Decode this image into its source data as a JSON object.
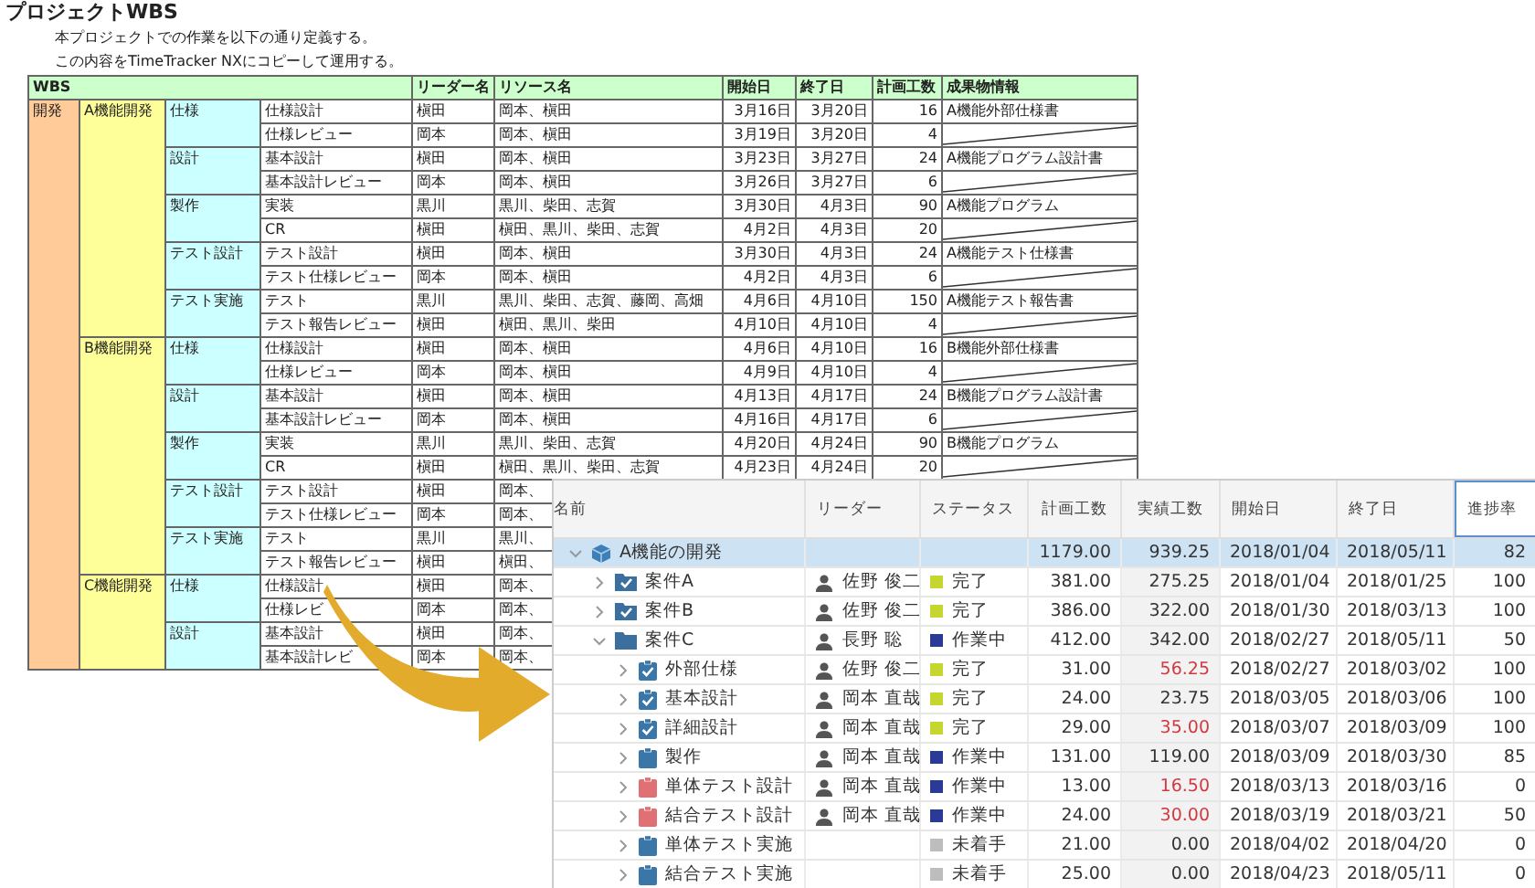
{
  "title": "プロジェクトWBS",
  "intro": [
    "本プロジェクトでの作業を以下の通り定義する。",
    "この内容をTimeTracker NXにコピーして運用する。"
  ],
  "wbs": {
    "columns": [
      "WBS",
      "リーダー名",
      "リソース名",
      "開始日",
      "終了日",
      "計画工数",
      "成果物情報"
    ],
    "groups": [
      {
        "name": "開発",
        "features": [
          {
            "name": "A機能開発",
            "phases": [
              {
                "name": "仕様",
                "tasks": [
                  {
                    "name": "仕様設計",
                    "leader": "槇田",
                    "resources": "岡本、槇田",
                    "start": "3月16日",
                    "end": "3月20日",
                    "hours": "16",
                    "deliverable": "A機能外部仕様書"
                  },
                  {
                    "name": "仕様レビュー",
                    "leader": "岡本",
                    "resources": "岡本、槇田",
                    "start": "3月19日",
                    "end": "3月20日",
                    "hours": "4"
                  }
                ]
              },
              {
                "name": "設計",
                "tasks": [
                  {
                    "name": "基本設計",
                    "leader": "槇田",
                    "resources": "岡本、槇田",
                    "start": "3月23日",
                    "end": "3月27日",
                    "hours": "24",
                    "deliverable": "A機能プログラム設計書"
                  },
                  {
                    "name": "基本設計レビュー",
                    "leader": "岡本",
                    "resources": "岡本、槇田",
                    "start": "3月26日",
                    "end": "3月27日",
                    "hours": "6"
                  }
                ]
              },
              {
                "name": "製作",
                "tasks": [
                  {
                    "name": "実装",
                    "leader": "黒川",
                    "resources": "黒川、柴田、志賀",
                    "start": "3月30日",
                    "end": "4月3日",
                    "hours": "90",
                    "deliverable": "A機能プログラム"
                  },
                  {
                    "name": "CR",
                    "leader": "槇田",
                    "resources": "槇田、黒川、柴田、志賀",
                    "start": "4月2日",
                    "end": "4月3日",
                    "hours": "20"
                  }
                ]
              },
              {
                "name": "テスト設計",
                "tasks": [
                  {
                    "name": "テスト設計",
                    "leader": "槇田",
                    "resources": "岡本、槇田",
                    "start": "3月30日",
                    "end": "4月3日",
                    "hours": "24",
                    "deliverable": "A機能テスト仕様書"
                  },
                  {
                    "name": "テスト仕様レビュー",
                    "leader": "岡本",
                    "resources": "岡本、槇田",
                    "start": "4月2日",
                    "end": "4月3日",
                    "hours": "6"
                  }
                ]
              },
              {
                "name": "テスト実施",
                "tasks": [
                  {
                    "name": "テスト",
                    "leader": "黒川",
                    "resources": "黒川、柴田、志賀、藤岡、高畑",
                    "start": "4月6日",
                    "end": "4月10日",
                    "hours": "150",
                    "deliverable": "A機能テスト報告書"
                  },
                  {
                    "name": "テスト報告レビュー",
                    "leader": "槇田",
                    "resources": "槇田、黒川、柴田",
                    "start": "4月10日",
                    "end": "4月10日",
                    "hours": "4"
                  }
                ]
              }
            ]
          },
          {
            "name": "B機能開発",
            "phases": [
              {
                "name": "仕様",
                "tasks": [
                  {
                    "name": "仕様設計",
                    "leader": "槇田",
                    "resources": "岡本、槇田",
                    "start": "4月6日",
                    "end": "4月10日",
                    "hours": "16",
                    "deliverable": "B機能外部仕様書"
                  },
                  {
                    "name": "仕様レビュー",
                    "leader": "岡本",
                    "resources": "岡本、槇田",
                    "start": "4月9日",
                    "end": "4月10日",
                    "hours": "4"
                  }
                ]
              },
              {
                "name": "設計",
                "tasks": [
                  {
                    "name": "基本設計",
                    "leader": "槇田",
                    "resources": "岡本、槇田",
                    "start": "4月13日",
                    "end": "4月17日",
                    "hours": "24",
                    "deliverable": "B機能プログラム設計書"
                  },
                  {
                    "name": "基本設計レビュー",
                    "leader": "岡本",
                    "resources": "岡本、槇田",
                    "start": "4月16日",
                    "end": "4月17日",
                    "hours": "6"
                  }
                ]
              },
              {
                "name": "製作",
                "tasks": [
                  {
                    "name": "実装",
                    "leader": "黒川",
                    "resources": "黒川、柴田、志賀",
                    "start": "4月20日",
                    "end": "4月24日",
                    "hours": "90",
                    "deliverable": "B機能プログラム"
                  },
                  {
                    "name": "CR",
                    "leader": "槇田",
                    "resources": "槇田、黒川、柴田、志賀",
                    "start": "4月23日",
                    "end": "4月24日",
                    "hours": "20"
                  }
                ]
              },
              {
                "name": "テスト設計",
                "tasks": [
                  {
                    "name": "テスト設計",
                    "leader": "槇田",
                    "resources": "岡本、"
                  },
                  {
                    "name": "テスト仕様レビュー",
                    "leader": "岡本",
                    "resources": "岡本、"
                  }
                ]
              },
              {
                "name": "テスト実施",
                "tasks": [
                  {
                    "name": "テスト",
                    "leader": "黒川",
                    "resources": "黒川、"
                  },
                  {
                    "name": "テスト報告レビュー",
                    "leader": "槇田",
                    "resources": "槇田、"
                  }
                ]
              }
            ]
          },
          {
            "name": "C機能開発",
            "phases": [
              {
                "name": "仕様",
                "tasks": [
                  {
                    "name": "仕様設計",
                    "leader": "槇田",
                    "resources": "岡本、"
                  },
                  {
                    "name": "仕様レビ",
                    "leader": "岡本",
                    "resources": "岡本、"
                  }
                ]
              },
              {
                "name": "設計",
                "tasks": [
                  {
                    "name": "基本設計",
                    "leader": "槇田",
                    "resources": "岡本、"
                  },
                  {
                    "name": "基本設計レビ",
                    "leader": "岡本",
                    "resources": "岡本、"
                  }
                ]
              }
            ]
          }
        ]
      }
    ]
  },
  "tracker": {
    "columns": [
      {
        "label": "名前",
        "selected": false
      },
      {
        "label": "リーダー",
        "selected": false
      },
      {
        "label": "ステータス",
        "selected": false
      },
      {
        "label": "計画工数",
        "selected": false
      },
      {
        "label": "実績工数",
        "selected": false
      },
      {
        "label": "開始日",
        "selected": false
      },
      {
        "label": "終了日",
        "selected": false
      },
      {
        "label": "進捗率",
        "selected": true
      }
    ],
    "rows": [
      {
        "name": "A機能の開発",
        "kind": "project",
        "expanded": true,
        "selected": true,
        "plan": "1179.00",
        "actual": "939.25",
        "over": false,
        "start": "2018/01/04",
        "end": "2018/05/11",
        "progress": "82",
        "children": [
          {
            "name": "案件A",
            "kind": "case_done",
            "expanded": false,
            "selected": false,
            "leader": "佐野 俊二",
            "status": {
              "label": "完了",
              "color": "#c5d62e"
            },
            "plan": "381.00",
            "actual": "275.25",
            "over": false,
            "start": "2018/01/04",
            "end": "2018/01/25",
            "progress": "100"
          },
          {
            "name": "案件B",
            "kind": "case_done",
            "expanded": false,
            "selected": false,
            "leader": "佐野 俊二",
            "status": {
              "label": "完了",
              "color": "#c5d62e"
            },
            "plan": "386.00",
            "actual": "322.00",
            "over": false,
            "start": "2018/01/30",
            "end": "2018/03/13",
            "progress": "100"
          },
          {
            "name": "案件C",
            "kind": "case",
            "expanded": true,
            "selected": false,
            "leader": "長野 聡",
            "status": {
              "label": "作業中",
              "color": "#2b3a96"
            },
            "plan": "412.00",
            "actual": "342.00",
            "over": false,
            "start": "2018/02/27",
            "end": "2018/05/11",
            "progress": "50",
            "children": [
              {
                "name": "外部仕様",
                "kind": "task_done",
                "expanded": false,
                "selected": false,
                "leader": "佐野 俊二",
                "status": {
                  "label": "完了",
                  "color": "#c5d62e"
                },
                "plan": "31.00",
                "actual": "56.25",
                "over": true,
                "start": "2018/02/27",
                "end": "2018/03/02",
                "progress": "100"
              },
              {
                "name": "基本設計",
                "kind": "task_done",
                "expanded": false,
                "selected": false,
                "leader": "岡本 直哉",
                "status": {
                  "label": "完了",
                  "color": "#c5d62e"
                },
                "plan": "24.00",
                "actual": "23.75",
                "over": false,
                "start": "2018/03/05",
                "end": "2018/03/06",
                "progress": "100"
              },
              {
                "name": "詳細設計",
                "kind": "task_done",
                "expanded": false,
                "selected": false,
                "leader": "岡本 直哉",
                "status": {
                  "label": "完了",
                  "color": "#c5d62e"
                },
                "plan": "29.00",
                "actual": "35.00",
                "over": true,
                "start": "2018/03/07",
                "end": "2018/03/09",
                "progress": "100"
              },
              {
                "name": "製作",
                "kind": "task",
                "expanded": false,
                "selected": false,
                "leader": "岡本 直哉",
                "status": {
                  "label": "作業中",
                  "color": "#2b3a96"
                },
                "plan": "131.00",
                "actual": "119.00",
                "over": false,
                "start": "2018/03/09",
                "end": "2018/03/30",
                "progress": "85"
              },
              {
                "name": "単体テスト設計",
                "kind": "task_late",
                "expanded": false,
                "selected": false,
                "leader": "岡本 直哉",
                "status": {
                  "label": "作業中",
                  "color": "#2b3a96"
                },
                "plan": "13.00",
                "actual": "16.50",
                "over": true,
                "start": "2018/03/13",
                "end": "2018/03/16",
                "progress": "0"
              },
              {
                "name": "結合テスト設計",
                "kind": "task_late",
                "expanded": false,
                "selected": false,
                "leader": "岡本 直哉",
                "status": {
                  "label": "作業中",
                  "color": "#2b3a96"
                },
                "plan": "24.00",
                "actual": "30.00",
                "over": true,
                "start": "2018/03/19",
                "end": "2018/03/21",
                "progress": "50"
              },
              {
                "name": "単体テスト実施",
                "kind": "task",
                "expanded": false,
                "selected": false,
                "status": {
                  "label": "未着手",
                  "color": "#bdbdbd"
                },
                "plan": "21.00",
                "actual": "0.00",
                "over": false,
                "start": "2018/04/02",
                "end": "2018/04/20",
                "progress": "0"
              },
              {
                "name": "結合テスト実施",
                "kind": "task",
                "expanded": false,
                "selected": false,
                "status": {
                  "label": "未着手",
                  "color": "#bdbdbd"
                },
                "plan": "25.00",
                "actual": "0.00",
                "over": false,
                "start": "2018/04/23",
                "end": "2018/05/11",
                "progress": "0"
              }
            ]
          }
        ]
      }
    ]
  }
}
